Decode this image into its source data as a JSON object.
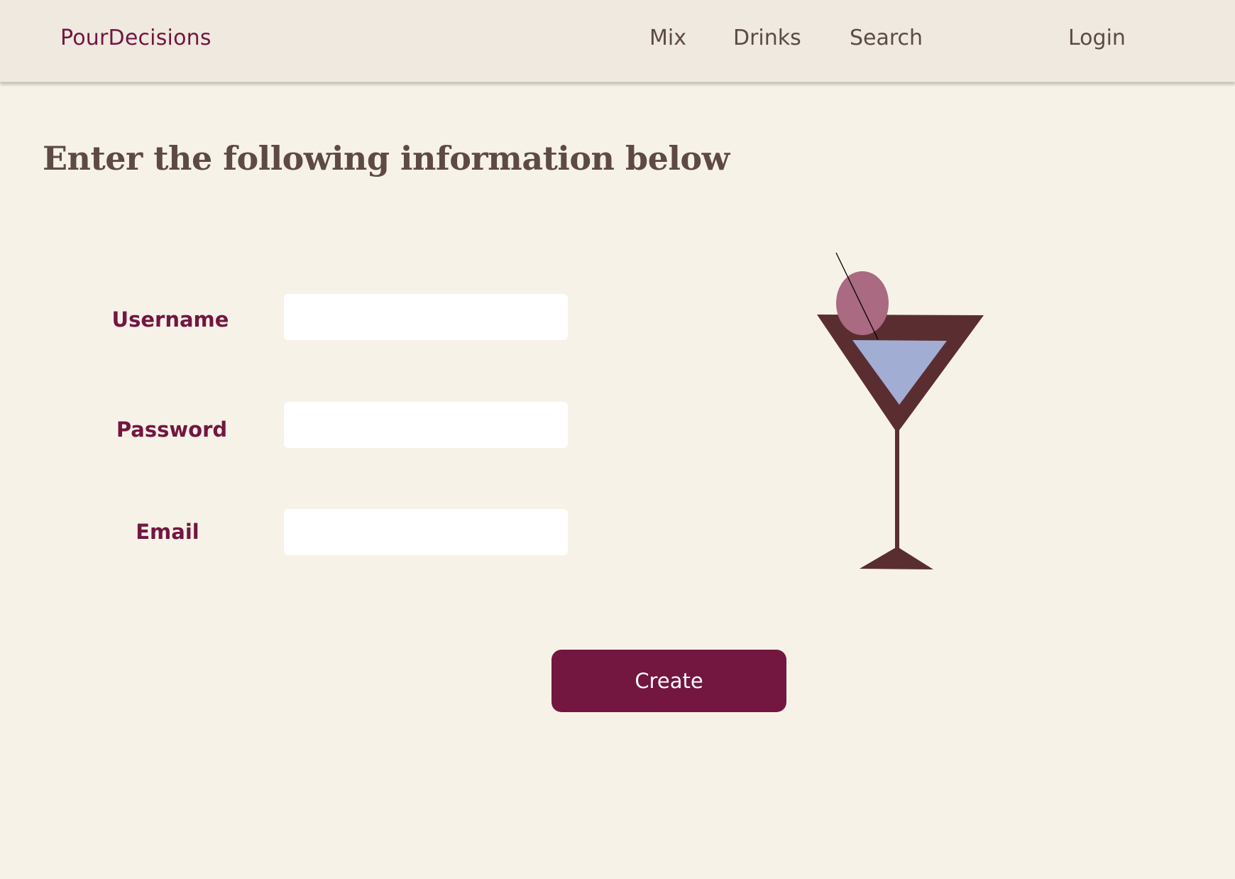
{
  "app": {
    "brand": "PourDecisions"
  },
  "nav": {
    "mix": "Mix",
    "drinks": "Drinks",
    "search": "Search",
    "login": "Login"
  },
  "main": {
    "title": "Enter the following information below"
  },
  "form": {
    "username_label": "Username",
    "username_value": "",
    "password_label": "Password",
    "password_value": "",
    "email_label": "Email",
    "email_value": "",
    "create_label": "Create"
  },
  "colors": {
    "accent": "#731640",
    "background": "#f7f2e8",
    "navbar": "#efe9df",
    "text": "#5e4a45",
    "glass": "#5a2e30",
    "liquid": "#a2add3",
    "olive": "#a96a82"
  },
  "icons": {
    "illustration": "martini-glass-icon"
  }
}
